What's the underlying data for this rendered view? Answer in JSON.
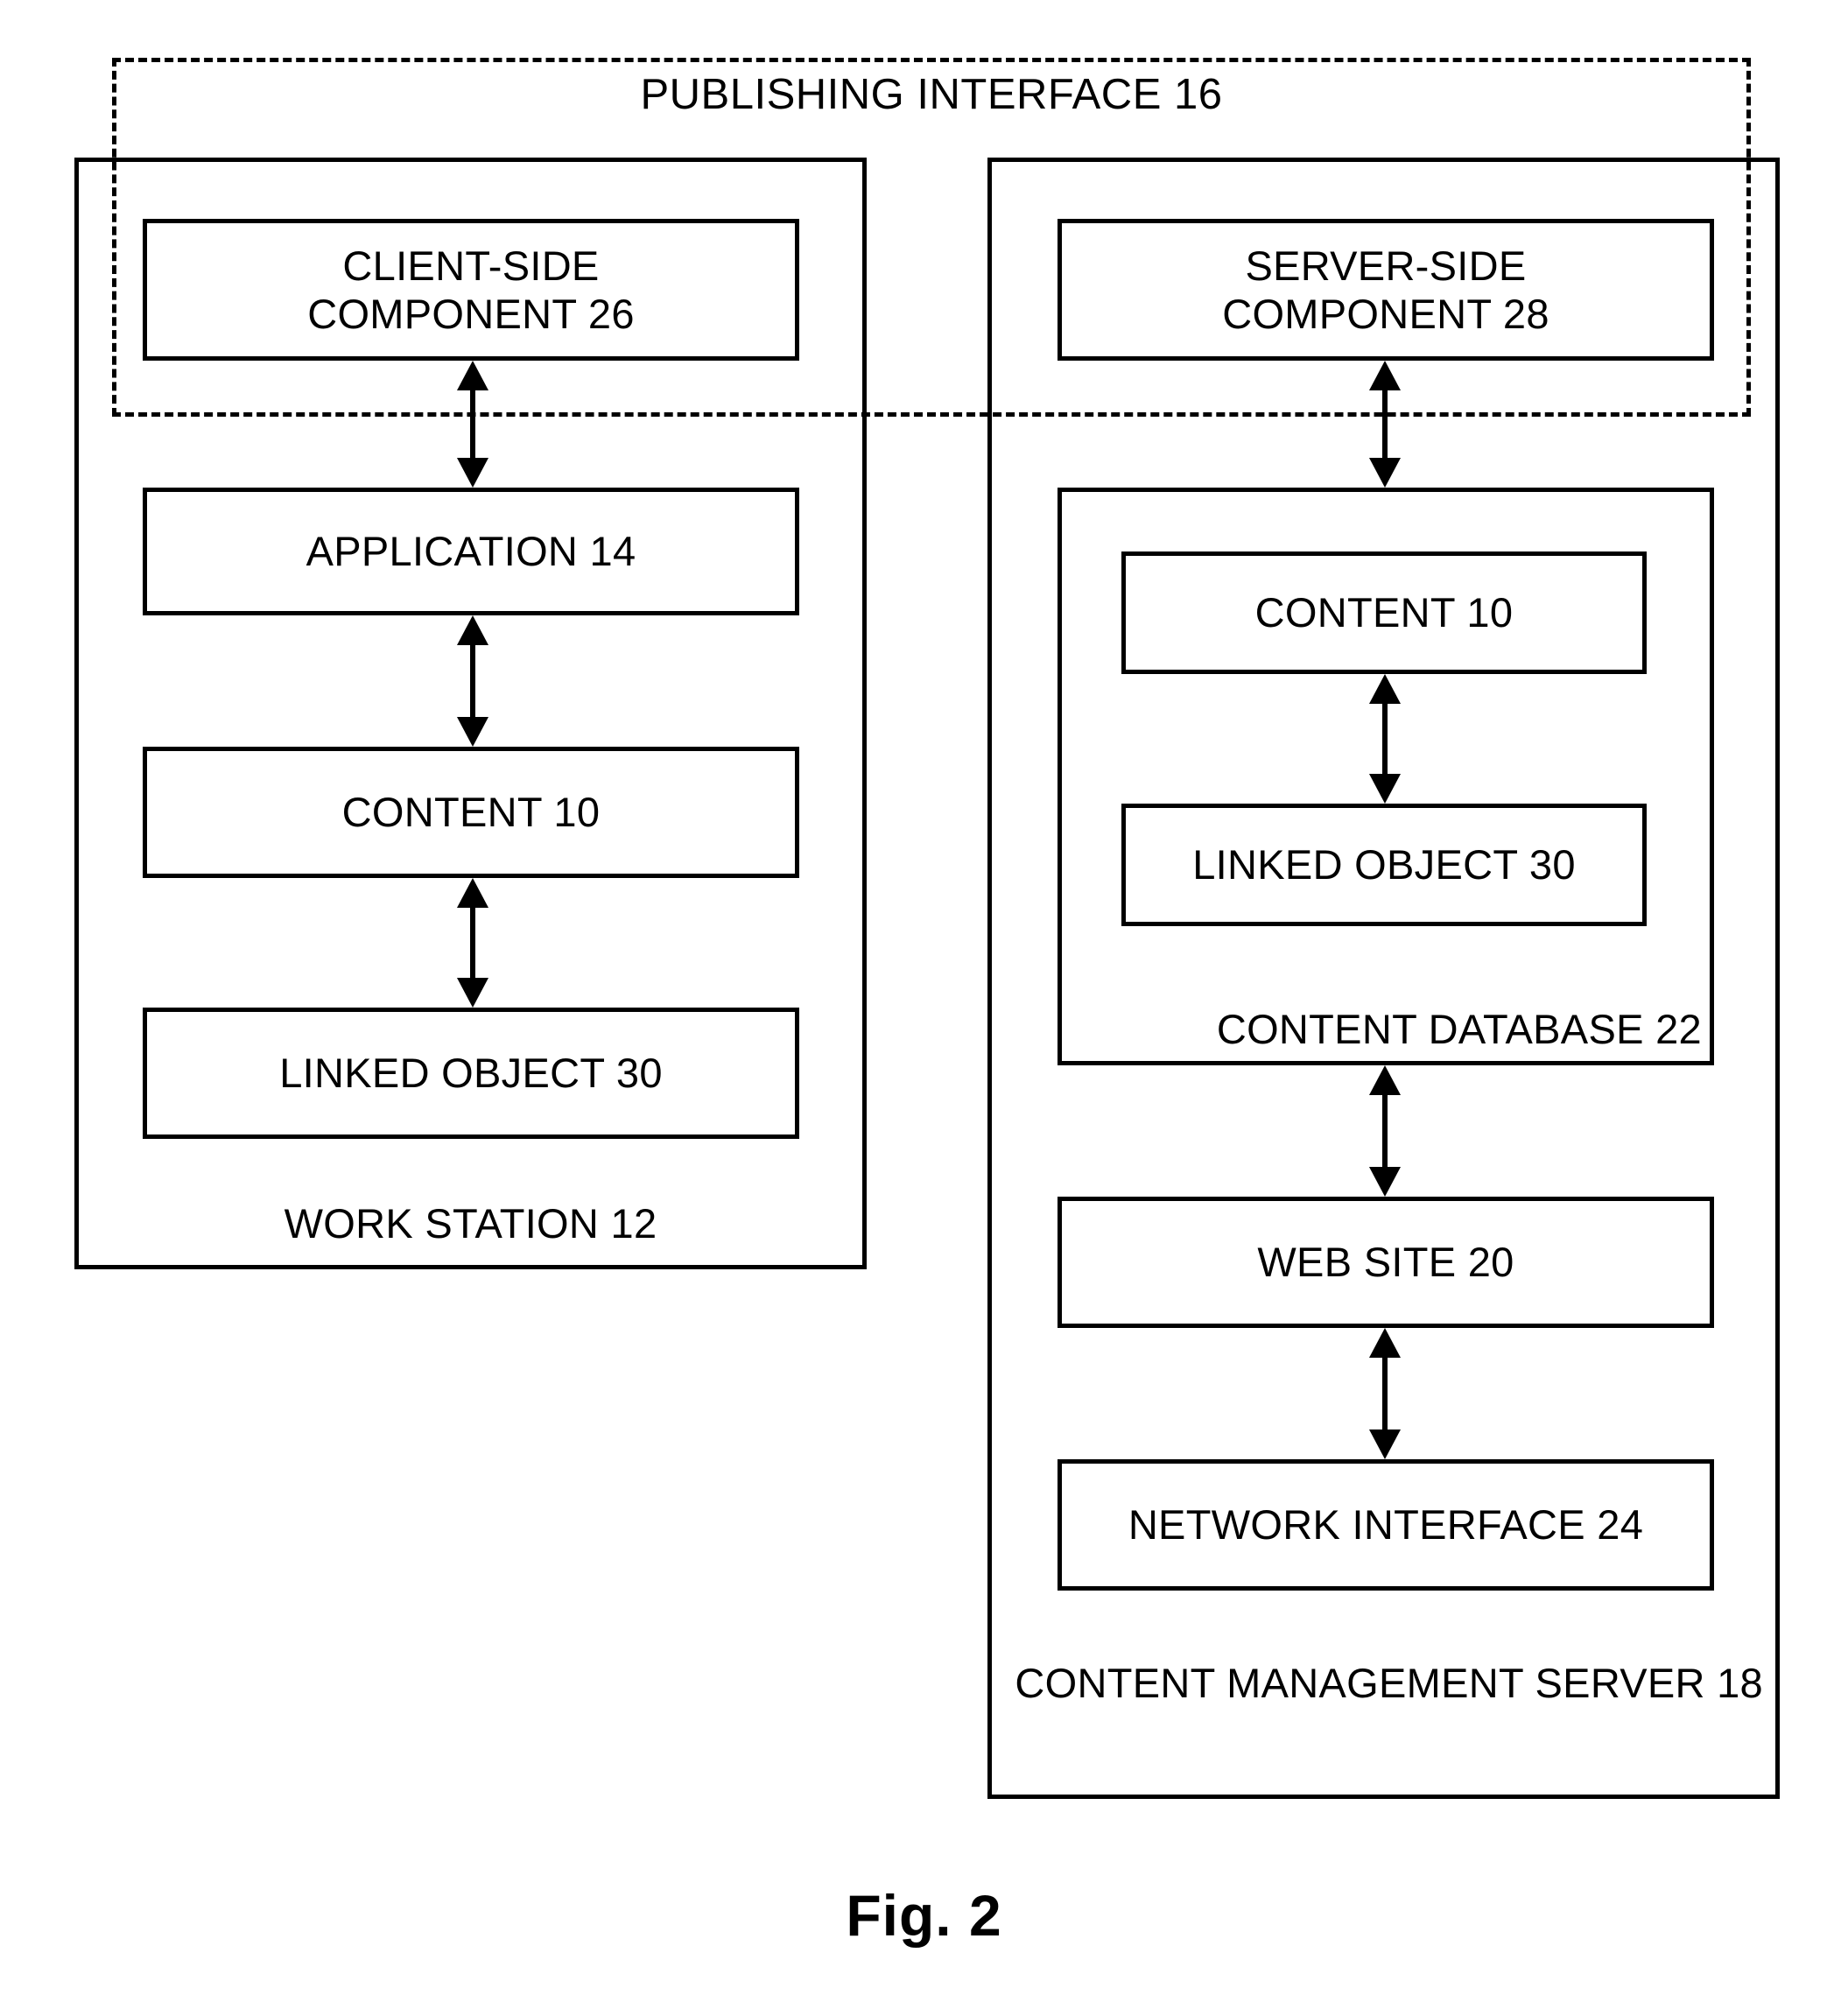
{
  "figure": {
    "caption": "Fig. 2",
    "publishing_interface": {
      "label": "PUBLISHING INTERFACE 16"
    },
    "workstation": {
      "caption": "WORK STATION 12",
      "nodes": [
        {
          "line1": "CLIENT-SIDE",
          "line2": "COMPONENT 26"
        },
        {
          "line1": "APPLICATION 14",
          "line2": ""
        },
        {
          "line1": "CONTENT 10",
          "line2": ""
        },
        {
          "line1": "LINKED OBJECT 30",
          "line2": ""
        }
      ]
    },
    "server": {
      "caption_line1": "CONTENT MANAGEMENT",
      "caption_line2": "SERVER 18",
      "nodes": [
        {
          "line1": "SERVER-SIDE",
          "line2": "COMPONENT 28"
        },
        {
          "line1": "WEB SITE 20",
          "line2": ""
        },
        {
          "line1": "NETWORK INTERFACE 24",
          "line2": ""
        }
      ],
      "content_database": {
        "caption": "CONTENT DATABASE 22",
        "nodes": [
          {
            "line1": "CONTENT 10",
            "line2": ""
          },
          {
            "line1": "LINKED OBJECT 30",
            "line2": ""
          }
        ]
      }
    },
    "connectors": [
      {
        "name": "client-component-to-application",
        "kind": "double-headed-vertical"
      },
      {
        "name": "application-to-content",
        "kind": "double-headed-vertical"
      },
      {
        "name": "content-to-linked-object",
        "kind": "double-headed-vertical"
      },
      {
        "name": "server-component-to-content-database",
        "kind": "double-headed-vertical"
      },
      {
        "name": "content-to-linked-object-server",
        "kind": "double-headed-vertical"
      },
      {
        "name": "content-database-to-web-site",
        "kind": "double-headed-vertical"
      },
      {
        "name": "web-site-to-network-interface",
        "kind": "double-headed-vertical"
      }
    ]
  },
  "colors": {
    "stroke": "#000000",
    "background": "#ffffff"
  }
}
